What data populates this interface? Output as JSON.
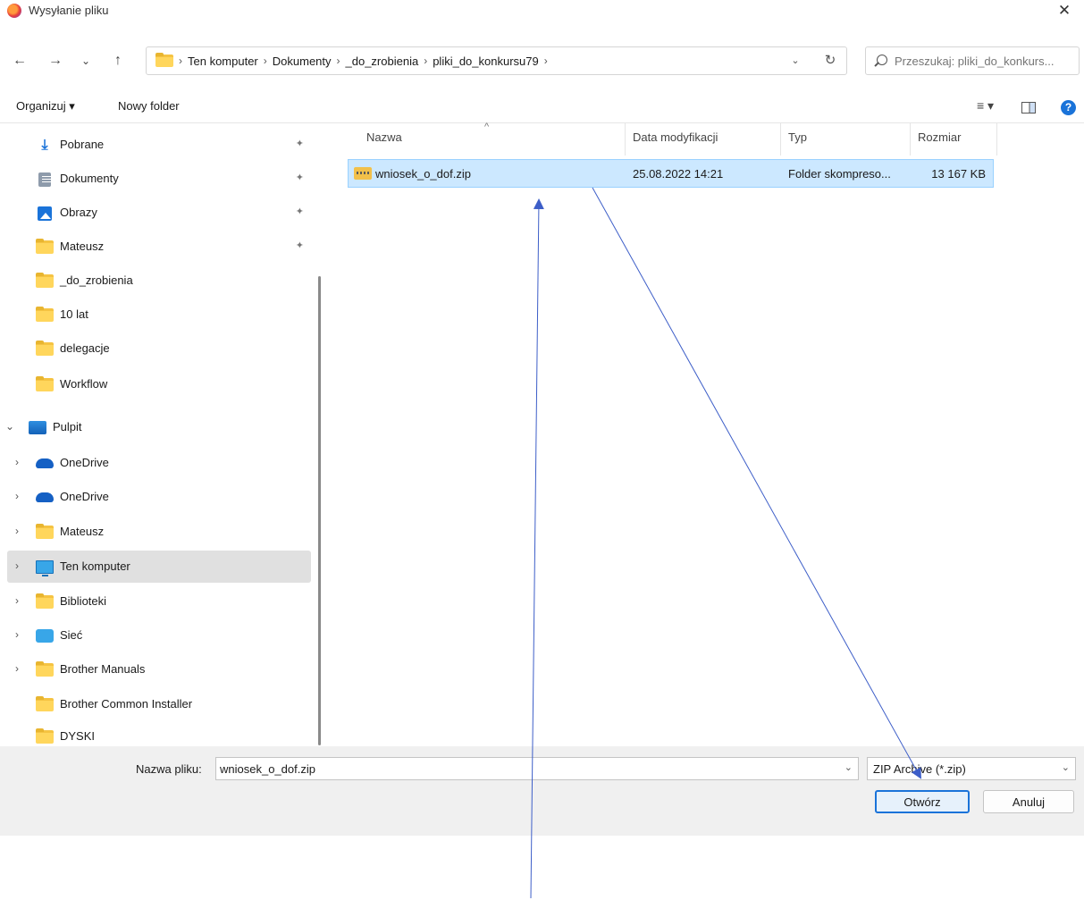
{
  "window": {
    "title": "Wysyłanie pliku",
    "close_glyph": "✕"
  },
  "nav": {
    "back": "←",
    "forward": "→",
    "recent": "⌄",
    "up": "↑"
  },
  "address": {
    "segments": [
      "Ten komputer",
      "Dokumenty",
      "_do_zrobienia",
      "pliki_do_konkursu79"
    ],
    "separator": "›",
    "dropdown_glyph": "⌄",
    "refresh_glyph": "↻"
  },
  "search": {
    "placeholder": "Przeszukaj: pliki_do_konkurs..."
  },
  "toolbar": {
    "organize": "Organizuj ▾",
    "new_folder": "Nowy folder",
    "view_glyph": "≡ ▾",
    "help_glyph": "?"
  },
  "sidebar": {
    "items": [
      {
        "label": "Pobrane",
        "icon": "download-icon",
        "pinned": true
      },
      {
        "label": "Dokumenty",
        "icon": "document-icon",
        "pinned": true
      },
      {
        "label": "Obrazy",
        "icon": "pictures-icon",
        "pinned": true
      },
      {
        "label": "Mateusz",
        "icon": "folder-icon",
        "pinned": true
      },
      {
        "label": "_do_zrobienia",
        "icon": "folder-icon"
      },
      {
        "label": "10 lat",
        "icon": "folder-icon"
      },
      {
        "label": "delegacje",
        "icon": "folder-icon"
      },
      {
        "label": "Workflow",
        "icon": "folder-icon"
      },
      {
        "label": "Pulpit",
        "icon": "desktop-icon",
        "expanded": true
      },
      {
        "label": "OneDrive",
        "icon": "onedrive-icon"
      },
      {
        "label": "OneDrive",
        "icon": "onedrive-icon"
      },
      {
        "label": "Mateusz",
        "icon": "folder-icon"
      },
      {
        "label": "Ten komputer",
        "icon": "computer-icon",
        "selected": true
      },
      {
        "label": "Biblioteki",
        "icon": "library-icon"
      },
      {
        "label": "Sieć",
        "icon": "network-icon"
      },
      {
        "label": "Brother Manuals",
        "icon": "folder-icon"
      },
      {
        "label": "Brother Common Installer",
        "icon": "folder-icon"
      },
      {
        "label": "DYSKI",
        "icon": "folder-icon"
      }
    ],
    "pin_glyph": "📌",
    "chevron_right": "›",
    "chevron_down": "⌄"
  },
  "columns": {
    "name": "Nazwa",
    "modified": "Data modyfikacji",
    "type": "Typ",
    "size": "Rozmiar",
    "sort_glyph": "^"
  },
  "files": [
    {
      "name": "wniosek_o_dof.zip",
      "modified": "25.08.2022 14:21",
      "type": "Folder skompreso...",
      "size": "13 167 KB"
    }
  ],
  "footer": {
    "filename_label": "Nazwa pliku:",
    "filename_value": "wniosek_o_dof.zip",
    "filetype": "ZIP Archive (*.zip)",
    "open": "Otwórz",
    "cancel": "Anuluj",
    "dropdown_glyph": "⌄"
  },
  "colors": {
    "accent": "#1a73d9",
    "selection": "#cce8ff",
    "arrow": "#3d5ec8"
  }
}
